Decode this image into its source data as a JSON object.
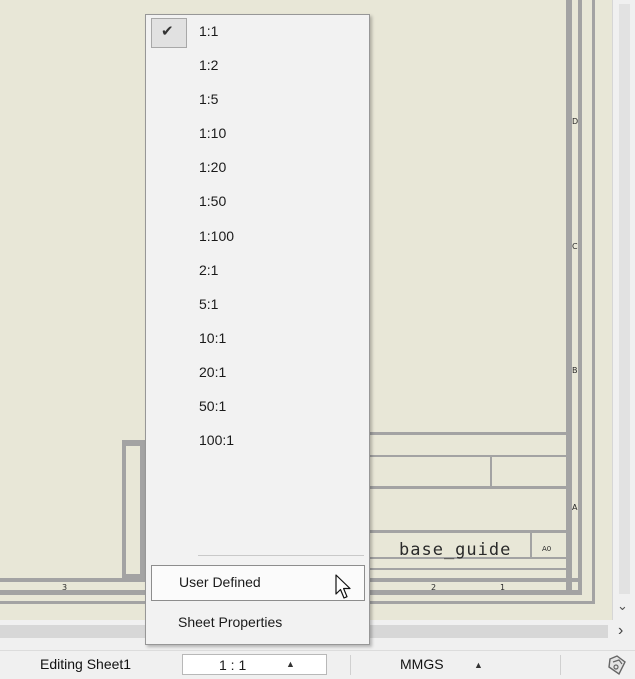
{
  "scale_menu": {
    "items": [
      {
        "label": "1:1",
        "checked": true
      },
      {
        "label": "1:2"
      },
      {
        "label": "1:5"
      },
      {
        "label": "1:10"
      },
      {
        "label": "1:20"
      },
      {
        "label": "1:50"
      },
      {
        "label": "1:100"
      },
      {
        "label": "2:1"
      },
      {
        "label": "5:1"
      },
      {
        "label": "10:1"
      },
      {
        "label": "20:1"
      },
      {
        "label": "50:1"
      },
      {
        "label": "100:1"
      }
    ],
    "user_defined": "User Defined",
    "sheet_properties": "Sheet Properties",
    "check_icon": "checkmark-icon"
  },
  "drawing": {
    "zone_letters": [
      "D",
      "C",
      "B",
      "A"
    ],
    "bottom_zones": [
      "3",
      "2",
      "1"
    ],
    "part_name": "base_guide",
    "sheet_size": "A0"
  },
  "statusbar": {
    "sheet_label": "Editing Sheet1",
    "scale_value": "1 : 1",
    "units": "MMGS",
    "rebuild_icon": "rebuild-icon"
  },
  "colors": {
    "sheet_background": "#e8e7d7",
    "menu_background": "#f2f2f2",
    "border_gray": "#a3a3a3"
  }
}
